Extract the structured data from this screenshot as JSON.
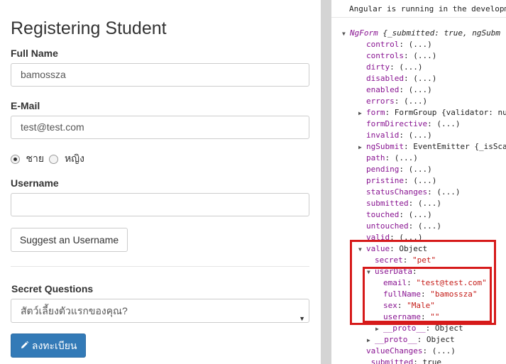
{
  "form": {
    "title": "Registering Student",
    "full_name_label": "Full Name",
    "full_name_value": "bamossza",
    "email_label": "E-Mail",
    "email_value": "test@test.com",
    "gender_options": [
      {
        "label": "ชาย",
        "checked": true
      },
      {
        "label": "หญิง",
        "checked": false
      }
    ],
    "username_label": "Username",
    "username_value": "",
    "suggest_button": "Suggest an Username",
    "secret_label": "Secret Questions",
    "secret_selected": "สัตว์เลี้ยงตัวแรกของคุณ?",
    "submit_button": "ลงทะเบียน",
    "submit_icon": "pencil-icon"
  },
  "console": {
    "message": "Angular is running in the developm",
    "lines": [
      {
        "arrow": "▼",
        "key": "NgForm",
        "value": " {_submitted: true, ngSubm"
      },
      {
        "key": "control",
        "value": ": (...)"
      },
      {
        "key": "controls",
        "value": ": (...)"
      },
      {
        "key": "dirty",
        "value": ": (...)"
      },
      {
        "key": "disabled",
        "value": ": (...)"
      },
      {
        "key": "enabled",
        "value": ": (...)"
      },
      {
        "key": "errors",
        "value": ": (...)"
      },
      {
        "arrow": "▶",
        "key": "form",
        "value": ": FormGroup {validator: nu"
      },
      {
        "key": "formDirective",
        "value": ": (...)"
      },
      {
        "key": "invalid",
        "value": ": (...)"
      },
      {
        "arrow": "▶",
        "key": "ngSubmit",
        "value": ": EventEmitter {_isSca"
      },
      {
        "key": "path",
        "value": ": (...)"
      },
      {
        "key": "pending",
        "value": ": (...)"
      },
      {
        "key": "pristine",
        "value": ": (...)"
      },
      {
        "key": "statusChanges",
        "value": ": (...)"
      },
      {
        "key": "submitted",
        "value": ": (...)"
      },
      {
        "key": "touched",
        "value": ": (...)"
      },
      {
        "key": "untouched",
        "value": ": (...)"
      },
      {
        "key": "valid",
        "value": ": (...)"
      },
      {
        "arrow": "▼",
        "key": "value",
        "value": ": Object"
      },
      {
        "key": "secret",
        "value": ": ",
        "str": "\"pet\""
      },
      {
        "arrow": "▼",
        "key": "userData",
        "value": ":"
      },
      {
        "key": "email",
        "value": ": ",
        "str": "\"test@test.com\""
      },
      {
        "key": "fullName",
        "value": ": ",
        "str": "\"bamossza\""
      },
      {
        "key": "sex",
        "value": ": ",
        "str": "\"Male\""
      },
      {
        "key": "username",
        "value": ": ",
        "str": "\"\""
      },
      {
        "arrow": "▶",
        "key": "__proto__",
        "value": ": Object"
      },
      {
        "arrow": "▶",
        "key": "__proto__",
        "value": ": Object"
      },
      {
        "key": "valueChanges",
        "value": ": (...)"
      },
      {
        "key": "_submitted",
        "value": ": true"
      }
    ]
  },
  "colors": {
    "highlight_box": "#d61a1a",
    "primary_button": "#337ab7",
    "property_key": "#881391",
    "string_value": "#c41a16"
  }
}
